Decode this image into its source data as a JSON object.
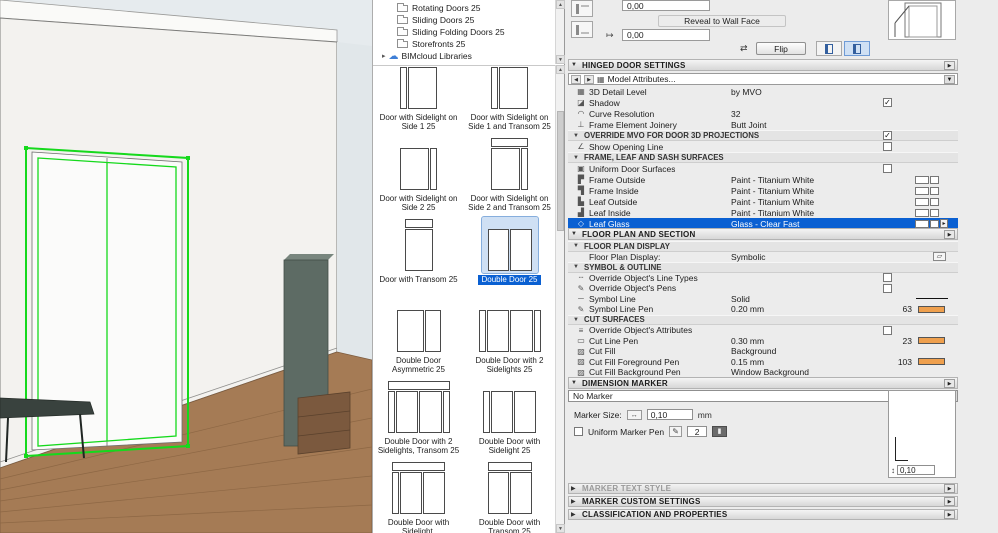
{
  "colors": {
    "selection_green": "#15d91c",
    "row_selected_bg": "#0a60d2",
    "pen_orange": "#efa04e",
    "thumb_selected_bg": "#cfe0f4"
  },
  "library_tree": {
    "items": [
      {
        "glyph": "folder",
        "label": "Rotating Doors 25"
      },
      {
        "glyph": "folder",
        "label": "Sliding Doors 25"
      },
      {
        "glyph": "folder",
        "label": "Sliding Folding Doors 25"
      },
      {
        "glyph": "folder",
        "label": "Storefronts 25"
      },
      {
        "glyph": "cloud",
        "label": "BIMcloud Libraries"
      }
    ]
  },
  "door_grid": {
    "items": [
      {
        "label": "Door with Sidelight on Side 1 25",
        "variant": "single-sideL",
        "selected": false
      },
      {
        "label": "Door with Sidelight on Side 1 and Transom 25",
        "variant": "single-sideL-transom",
        "selected": false
      },
      {
        "label": "Door with Sidelight on Side 2 25",
        "variant": "single-sideR",
        "selected": false
      },
      {
        "label": "Door with Sidelight on Side 2 and Transom 25",
        "variant": "single-sideR-transom",
        "selected": false
      },
      {
        "label": "Door with Transom 25",
        "variant": "single-transom",
        "selected": false
      },
      {
        "label": "Double Door 25",
        "variant": "double",
        "selected": true
      },
      {
        "label": "Double Door Asymmetric 25",
        "variant": "double-asym",
        "selected": false
      },
      {
        "label": "Double Door with 2 Sidelights 25",
        "variant": "double-2side",
        "selected": false
      },
      {
        "label": "Double Door with 2 Sidelights, Transom 25",
        "variant": "double-2side-transom",
        "selected": false
      },
      {
        "label": "Double Door with Sidelight 25",
        "variant": "double-sideL",
        "selected": false
      },
      {
        "label": "Double Door with Sidelight,",
        "variant": "double-sideL-transom",
        "selected": false
      },
      {
        "label": "Double Door with Transom 25",
        "variant": "double-transom",
        "selected": false
      }
    ]
  },
  "top_controls": {
    "offset_value": "0,00",
    "reveal_button_label": "Reveal to Wall Face",
    "reveal_value": "0,00",
    "flip_button_label": "Flip"
  },
  "sections": {
    "hinged": {
      "title": "HINGED DOOR SETTINGS",
      "model_attributes_label": "Model Attributes...",
      "rows": [
        {
          "name": "row-3d-detail-level",
          "icon": "▦",
          "label": "3D Detail Level",
          "value": "by MVO"
        },
        {
          "name": "row-shadow",
          "icon": "◪",
          "label": "Shadow",
          "check": "on"
        },
        {
          "name": "row-curve-resolution",
          "icon": "◠",
          "label": "Curve Resolution",
          "value": "32"
        },
        {
          "name": "row-frame-element-joinery",
          "icon": "⊥",
          "label": "Frame Element Joinery",
          "value": "Butt Joint"
        },
        {
          "type": "subheader",
          "name": "subheader-override-mvo",
          "label": "OVERRIDE MVO FOR DOOR 3D PROJECTIONS",
          "check": "on"
        },
        {
          "name": "row-show-opening-line",
          "icon": "∠",
          "label": "Show Opening Line",
          "check": "off"
        },
        {
          "type": "subheader",
          "name": "subheader-frame-leaf-sash-surfaces",
          "label": "FRAME, LEAF AND SASH SURFACES"
        },
        {
          "name": "row-uniform-door-surfaces",
          "icon": "▣",
          "label": "Uniform Door Surfaces",
          "check": "off"
        },
        {
          "name": "row-frame-outside",
          "icon": "▛",
          "label": "Frame Outside",
          "value": "Paint - Titanium White",
          "swatches": true
        },
        {
          "name": "row-frame-inside",
          "icon": "▜",
          "label": "Frame Inside",
          "value": "Paint - Titanium White",
          "swatches": true
        },
        {
          "name": "row-leaf-outside",
          "icon": "▙",
          "label": "Leaf Outside",
          "value": "Paint - Titanium White",
          "swatches": true
        },
        {
          "name": "row-leaf-inside",
          "icon": "▟",
          "label": "Leaf Inside",
          "value": "Paint - Titanium White",
          "swatches": true
        },
        {
          "name": "row-leaf-glass",
          "icon": "◇",
          "label": "Leaf Glass",
          "value": "Glass - Clear Fast",
          "swatches": true,
          "selected": true,
          "arrow": true
        }
      ]
    },
    "floorplan": {
      "title": "FLOOR PLAN AND SECTION",
      "rows": [
        {
          "type": "subheader",
          "name": "subheader-floor-plan-display",
          "label": "FLOOR PLAN DISPLAY"
        },
        {
          "name": "row-floor-plan-display",
          "icon": "",
          "label": "Floor Plan Display:",
          "value": "Symbolic",
          "tail_icon": true
        },
        {
          "type": "subheader",
          "name": "subheader-symbol-outline",
          "label": "SYMBOL & OUTLINE"
        },
        {
          "name": "row-override-line-types",
          "icon": "┄",
          "label": "Override Object's Line Types",
          "check": "off"
        },
        {
          "name": "row-override-pens",
          "icon": "✎",
          "label": "Override Object's Pens",
          "check": "off"
        },
        {
          "name": "row-symbol-line",
          "icon": "─",
          "label": "Symbol Line",
          "value": "Solid",
          "line_preview": true
        },
        {
          "name": "row-symbol-line-pen",
          "icon": "✎",
          "label": "Symbol Line Pen",
          "value": "0.20 mm",
          "pen": "63",
          "pen_swatch": true
        },
        {
          "type": "subheader",
          "name": "subheader-cut-surfaces",
          "label": "CUT SURFACES"
        },
        {
          "name": "row-override-attributes",
          "icon": "≡",
          "label": "Override Object's Attributes",
          "check": "off"
        },
        {
          "name": "row-cut-line-pen",
          "icon": "▭",
          "label": "Cut Line Pen",
          "value": "0.30 mm",
          "pen": "23",
          "pen_swatch": true
        },
        {
          "name": "row-cut-fill",
          "icon": "▨",
          "label": "Cut Fill",
          "value": "Background"
        },
        {
          "name": "row-cut-fill-foreground-pen",
          "icon": "▨",
          "label": "Cut Fill Foreground Pen",
          "value": "0.15 mm",
          "pen": "103",
          "pen_swatch": true
        },
        {
          "name": "row-cut-fill-background-pen",
          "icon": "▨",
          "label": "Cut Fill Background Pen",
          "value": "Window Background"
        }
      ]
    },
    "dimension_marker": {
      "title": "DIMENSION MARKER",
      "marker_dropdown_value": "No Marker",
      "marker_size_label": "Marker Size:",
      "marker_size_value": "0,10",
      "marker_size_unit": "mm",
      "uniform_marker_pen_label": "Uniform Marker Pen",
      "marker_pen_value": "2",
      "preview_value": "0,10"
    },
    "collapsed": [
      {
        "title": "MARKER TEXT STYLE",
        "disabled": true
      },
      {
        "title": "MARKER CUSTOM SETTINGS",
        "disabled": false
      },
      {
        "title": "CLASSIFICATION AND PROPERTIES",
        "disabled": false
      }
    ]
  }
}
